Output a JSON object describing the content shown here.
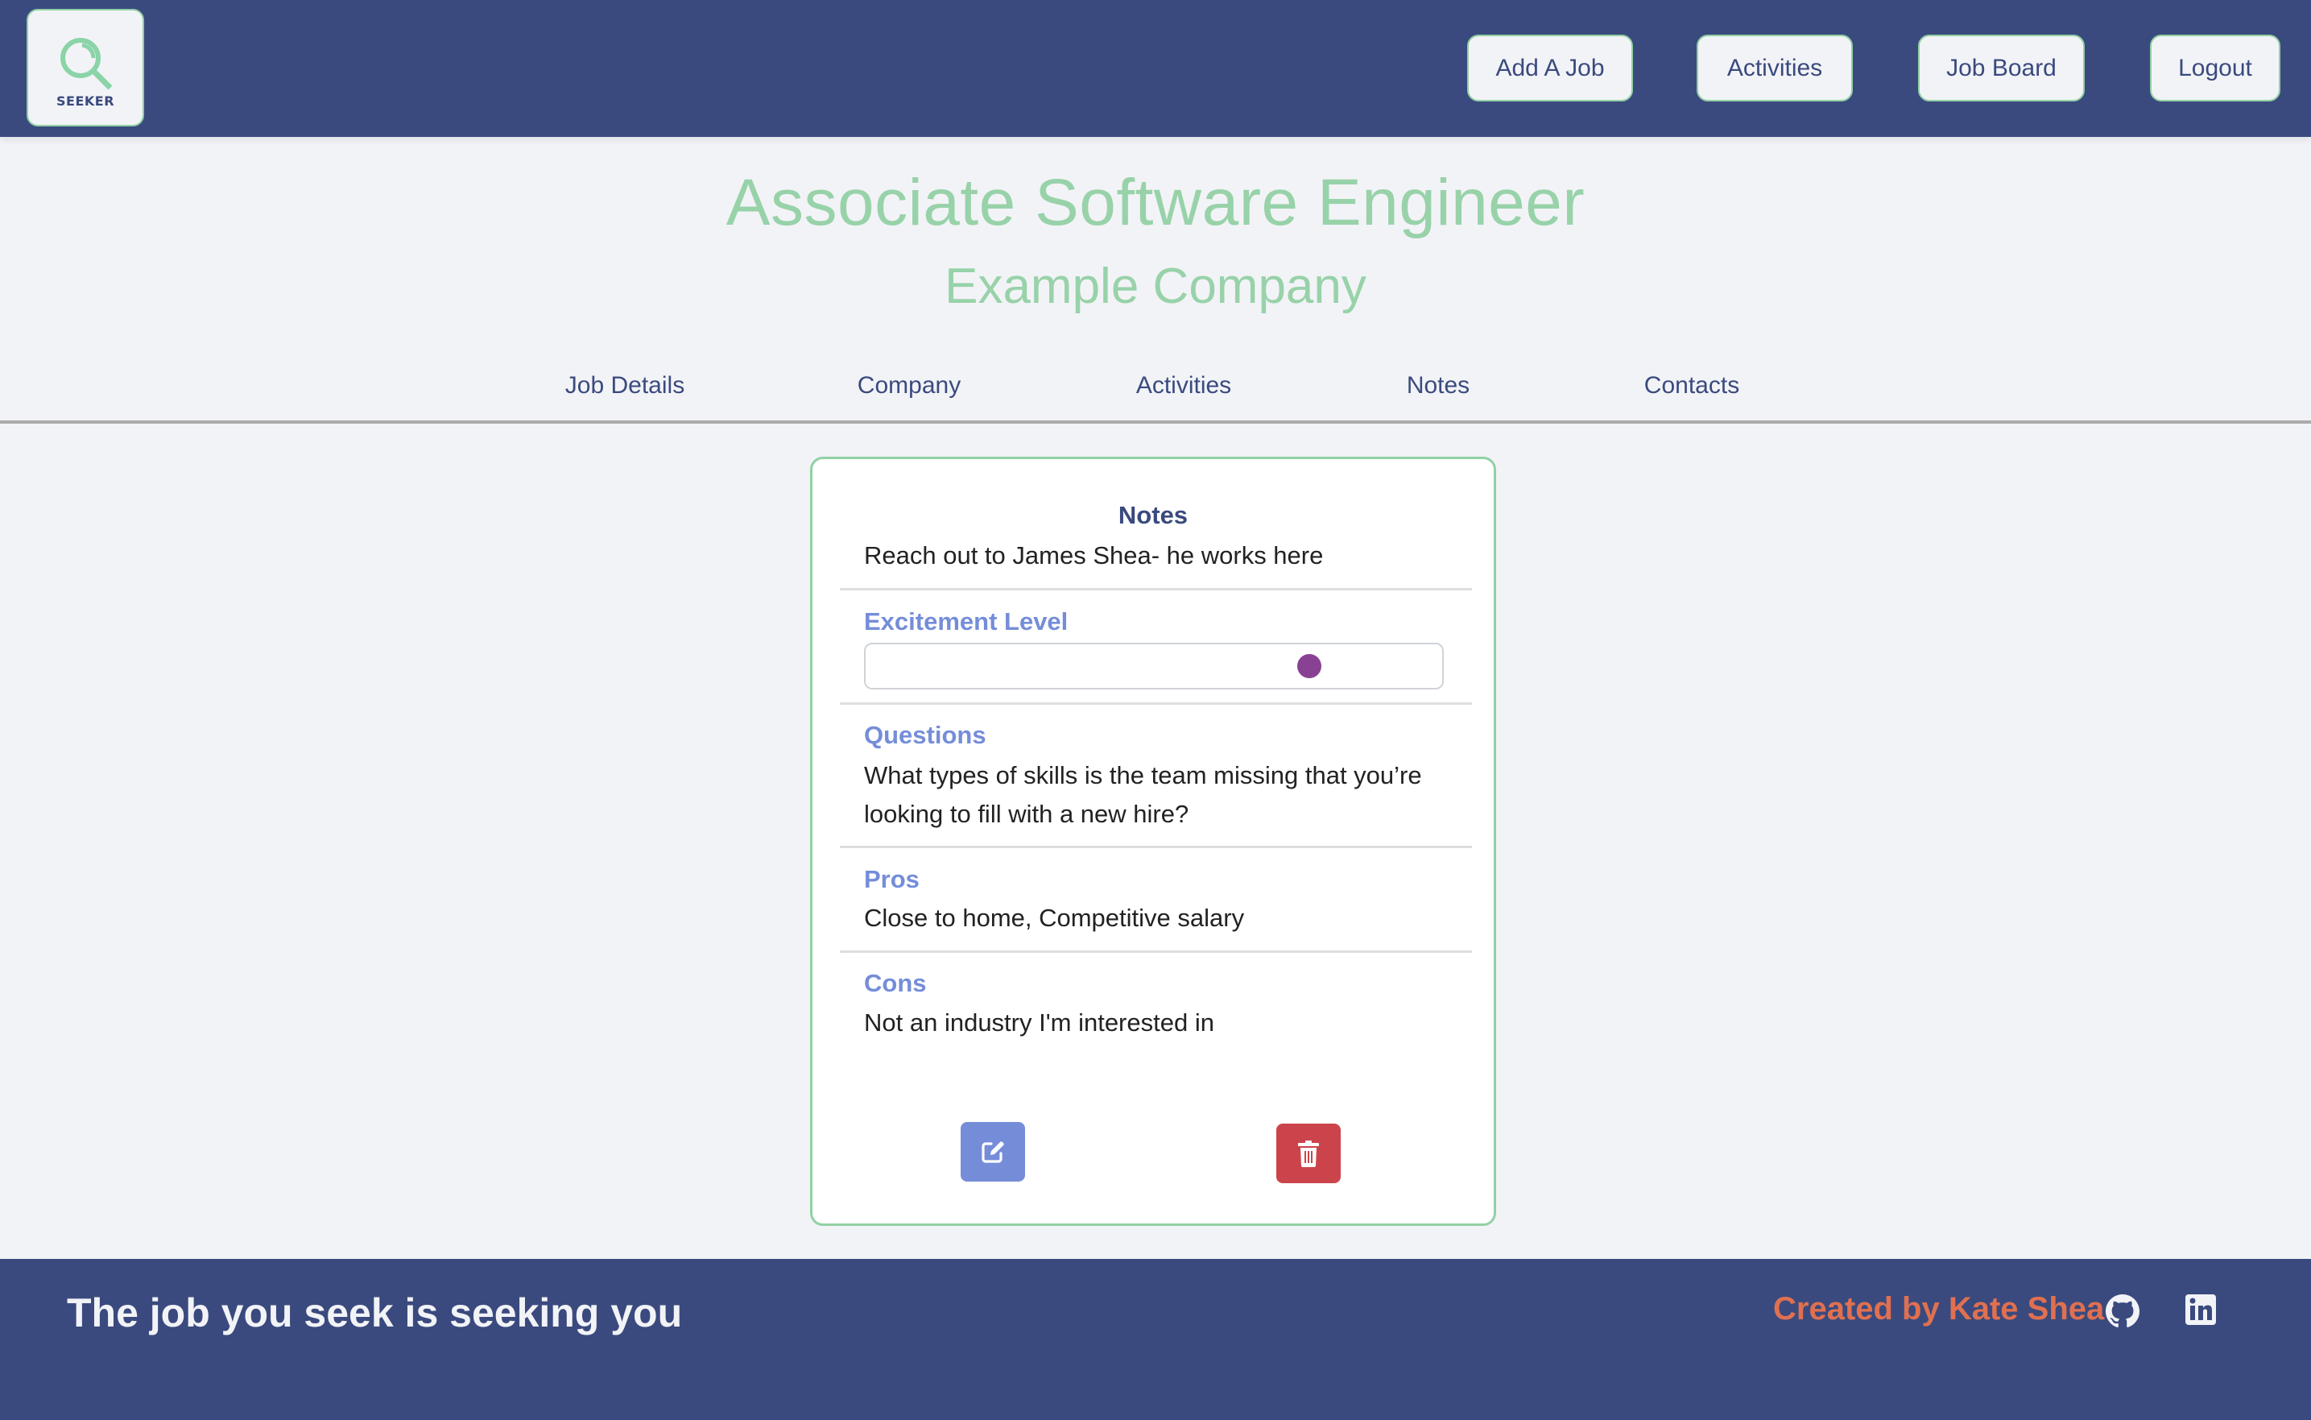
{
  "navbar": {
    "logo_text": "SEEKER",
    "buttons": [
      {
        "label": "Add A Job"
      },
      {
        "label": "Activities"
      },
      {
        "label": "Job Board"
      },
      {
        "label": "Logout"
      }
    ]
  },
  "job": {
    "title": "Associate Software Engineer",
    "company": "Example Company"
  },
  "tabs": [
    {
      "label": "Job Details"
    },
    {
      "label": "Company"
    },
    {
      "label": "Activities"
    },
    {
      "label": "Notes"
    },
    {
      "label": "Contacts"
    }
  ],
  "notes_card": {
    "heading": "Notes",
    "notes_text": "Reach out to James Shea- he works here",
    "excitement_label": "Excitement Level",
    "excitement_value_fraction": 0.77,
    "questions_label": "Questions",
    "questions_text": "What types of skills is the team missing that you’re looking to fill with a new hire?",
    "pros_label": "Pros",
    "pros_text": "Close to home, Competitive salary",
    "cons_label": "Cons",
    "cons_text": "Not an industry I'm interested in",
    "edit_icon": "edit-square-pencil-icon",
    "delete_icon": "trash-icon"
  },
  "footer": {
    "tagline": "The job you seek is seeking you",
    "credit": "Created by Kate Shea",
    "social_icons": [
      "github-icon",
      "linkedin-icon"
    ]
  },
  "colors": {
    "navbar_bg": "#3A4A7E",
    "accent_green": "#92D0A4",
    "label_blue": "#758DD9",
    "slider_thumb": "#894293",
    "delete_red": "#CC444B",
    "credit_orange": "#E07050",
    "page_bg": "#F2F3F7"
  }
}
